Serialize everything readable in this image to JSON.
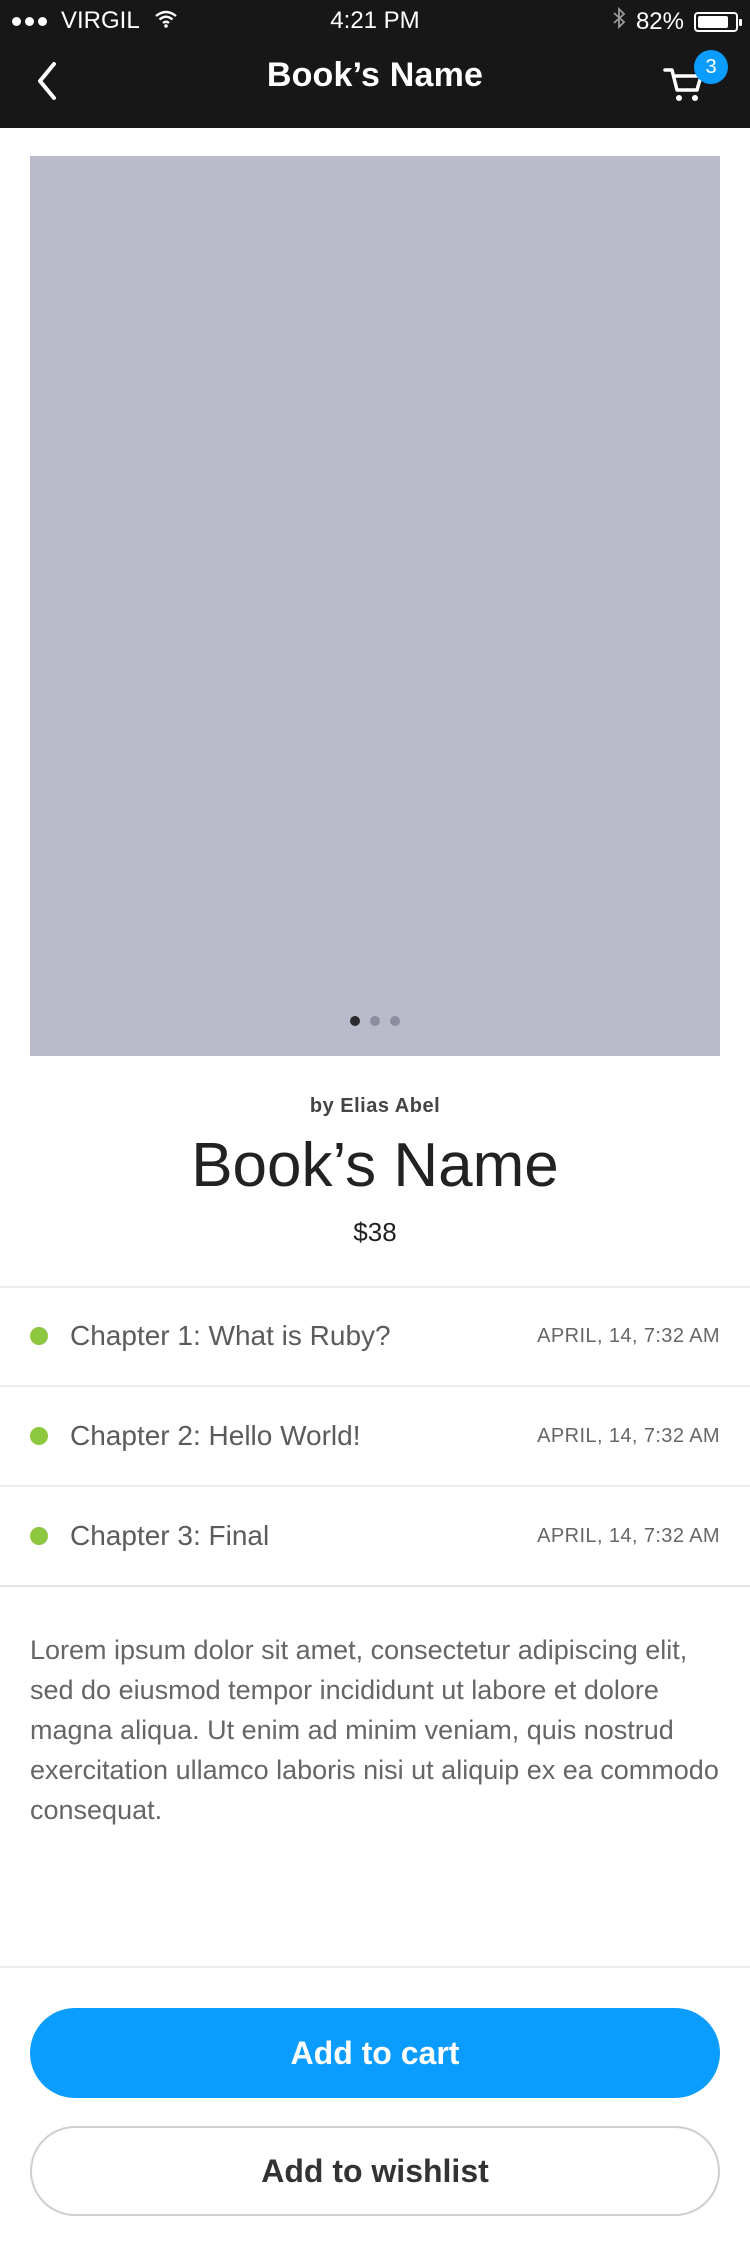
{
  "status": {
    "carrier": "VIRGIL",
    "time": "4:21 PM",
    "battery_percent_label": "82%",
    "battery_level": 0.82
  },
  "nav": {
    "title": "Book’s Name",
    "back_icon": "chevron-left-icon",
    "cart_icon": "cart-icon",
    "cart_count": "3"
  },
  "gallery": {
    "pages": 3,
    "active_page": 1
  },
  "book": {
    "author": "by Elias Abel",
    "title": "Book’s Name",
    "price": "$38"
  },
  "chapters": [
    {
      "name": "Chapter 1: What is Ruby?",
      "date": "APRIL, 14,  7:32 AM"
    },
    {
      "name": "Chapter 2: Hello World!",
      "date": "APRIL, 14,  7:32 AM"
    },
    {
      "name": "Chapter 3: Final",
      "date": "APRIL, 14,  7:32 AM"
    }
  ],
  "description": "Lorem ipsum dolor sit amet, consectetur adipiscing elit, sed do eiusmod tempor incididunt ut labore et dolore magna aliqua. Ut enim ad minim veniam, quis nostrud exercitation ullamco laboris nisi ut aliquip ex ea commodo consequat.",
  "actions": {
    "add_to_cart": "Add to cart",
    "add_to_wishlist": "Add to wishlist"
  },
  "colors": {
    "nav_background": "#171717",
    "accent_blue": "#0a9cff",
    "chapter_dot_green": "#8dc63f",
    "hero_placeholder": "#b9bbca"
  }
}
